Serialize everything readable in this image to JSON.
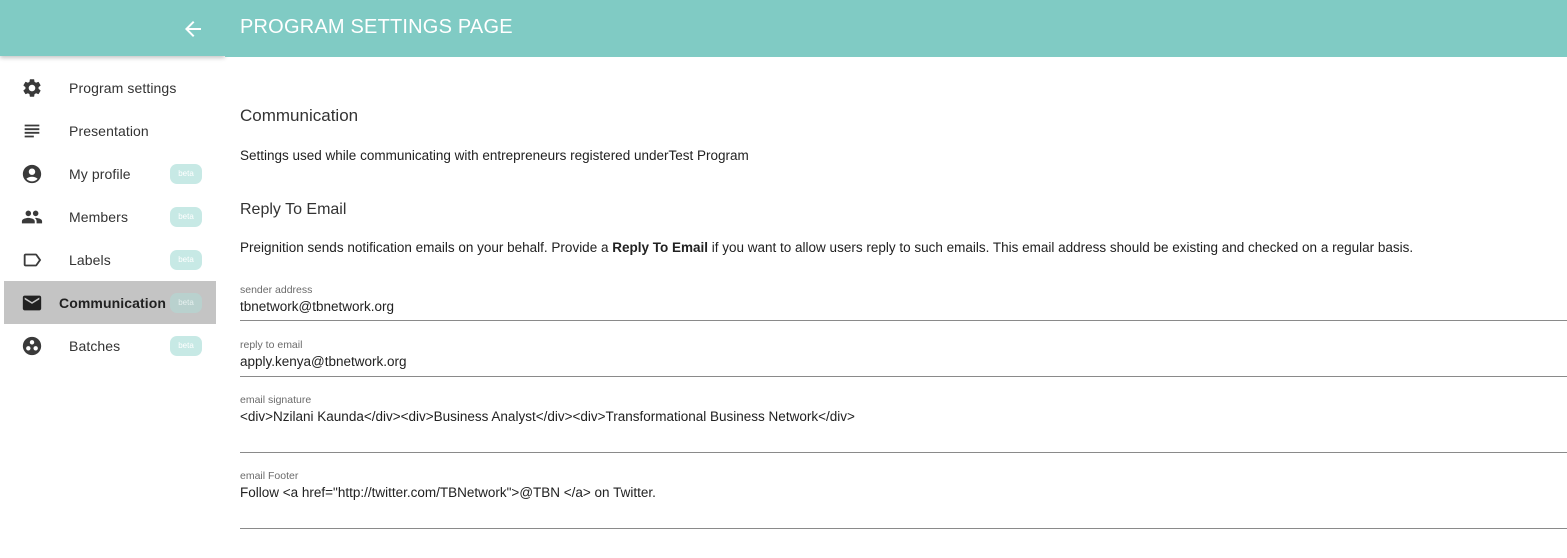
{
  "header": {
    "title": "PROGRAM SETTINGS PAGE"
  },
  "sidebar": {
    "items": [
      {
        "label": "Program settings",
        "icon": "gear-icon",
        "badge": ""
      },
      {
        "label": "Presentation",
        "icon": "lines-icon",
        "badge": ""
      },
      {
        "label": "My profile",
        "icon": "account-circle-icon",
        "badge": "beta"
      },
      {
        "label": "Members",
        "icon": "people-icon",
        "badge": "beta"
      },
      {
        "label": "Labels",
        "icon": "label-icon",
        "badge": "beta"
      },
      {
        "label": "Communication",
        "icon": "mail-icon",
        "badge": "beta",
        "active": true
      },
      {
        "label": "Batches",
        "icon": "workspaces-icon",
        "badge": "beta"
      }
    ]
  },
  "main": {
    "section_title": "Communication",
    "description": "Settings used while communicating with entrepreneurs registered underTest Program",
    "reply_title": "Reply To Email",
    "reply_desc_before": "Preignition sends notification emails on your behalf. Provide a ",
    "reply_desc_bold": "Reply To Email",
    "reply_desc_after": " if you want to allow users reply to such emails. This email address should be existing and checked on a regular basis.",
    "fields": [
      {
        "label": "sender address",
        "value": "tbnetwork@tbnetwork.org"
      },
      {
        "label": "reply to email",
        "value": "apply.kenya@tbnetwork.org"
      },
      {
        "label": "email signature",
        "value": "<div>Nzilani Kaunda</div><div>Business Analyst</div><div>Transformational Business Network</div>"
      },
      {
        "label": "email Footer",
        "value": "Follow <a href=\"http://twitter.com/TBNetwork\">@TBN </a> on Twitter."
      }
    ]
  },
  "colors": {
    "accent": "#80cbc4",
    "active_bg": "#c4c4c4",
    "badge_bg": "#c7e9e5"
  }
}
